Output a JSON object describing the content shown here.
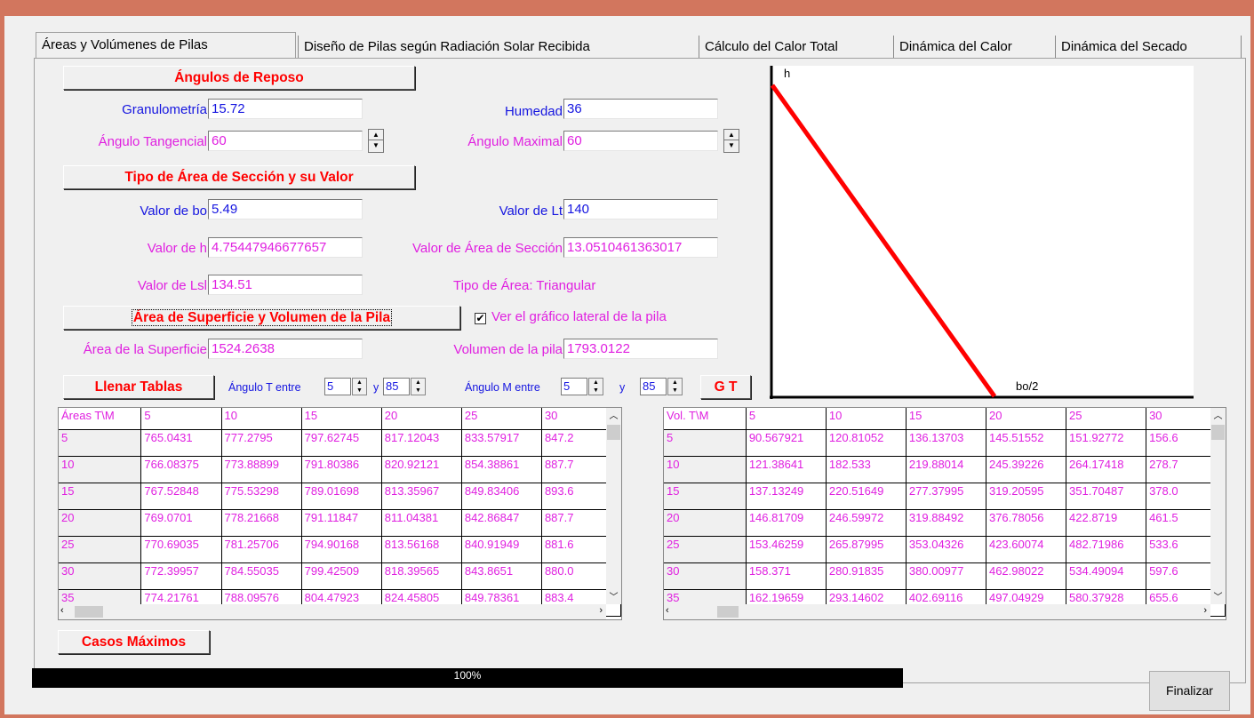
{
  "tabs": [
    "Áreas y Volúmenes de Pilas",
    "Diseño de Pilas según Radiación Solar Recibida",
    "Cálculo del Calor Total",
    "Dinámica del Calor",
    "Dinámica del Secado"
  ],
  "buttons": {
    "angulos_reposo": "Ángulos de Reposo",
    "tipo_area": "Tipo de Área de Sección y su Valor",
    "area_superficie": "Área de Superficie y Volumen de la Pila",
    "llenar_tablas": "Llenar Tablas",
    "gt": "G T",
    "casos_maximos": "Casos Máximos",
    "finalizar": "Finalizar"
  },
  "fields": {
    "granulometria": {
      "label": "Granulometría",
      "value": "15.72"
    },
    "humedad": {
      "label": "Humedad",
      "value": "36"
    },
    "angulo_tangencial": {
      "label": "Ángulo Tangencial",
      "value": "60"
    },
    "angulo_maximal": {
      "label": "Ángulo Maximal",
      "value": "60"
    },
    "valor_bo": {
      "label": "Valor de bo",
      "value": "5.49"
    },
    "valor_lt": {
      "label": "Valor de Lt",
      "value": "140"
    },
    "valor_h": {
      "label": "Valor de h",
      "value": "4.75447946677657"
    },
    "valor_area_seccion": {
      "label": "Valor de Área de Sección",
      "value": "13.0510461363017"
    },
    "valor_lsl": {
      "label": "Valor de Lsl",
      "value": "134.51"
    },
    "tipo_area": "Tipo de Área: Triangular",
    "area_superficie": {
      "label": "Área de la Superficie",
      "value": "1524.2638"
    },
    "volumen_pila": {
      "label": "Volumen de la pila",
      "value": "1793.0122"
    }
  },
  "checkbox": {
    "label": "Ver el gráfico lateral de la pila",
    "checked": "✔"
  },
  "range_controls": {
    "angulo_t_label": "Ángulo T entre",
    "angulo_t_min": "5",
    "angulo_t_max": "85",
    "y1": "y",
    "angulo_m_label": "Ángulo M entre",
    "angulo_m_min": "5",
    "angulo_m_max": "85",
    "y2": "y"
  },
  "chart": {
    "y_label": "h",
    "x_label": "bo/2"
  },
  "areas_table": {
    "headers": [
      "Áreas T\\M",
      "5",
      "10",
      "15",
      "20",
      "25",
      "30"
    ],
    "rows": [
      [
        "5",
        "765.0431",
        "777.2795",
        "797.62745",
        "817.12043",
        "833.57917",
        "847.2"
      ],
      [
        "10",
        "766.08375",
        "773.88899",
        "791.80386",
        "820.92121",
        "854.38861",
        "887.7"
      ],
      [
        "15",
        "767.52848",
        "775.53298",
        "789.01698",
        "813.35967",
        "849.83406",
        "893.6"
      ],
      [
        "20",
        "769.0701",
        "778.21668",
        "791.11847",
        "811.04381",
        "842.86847",
        "887.7"
      ],
      [
        "25",
        "770.69035",
        "781.25706",
        "794.90168",
        "813.56168",
        "840.91949",
        "881.6"
      ],
      [
        "30",
        "772.39957",
        "784.55035",
        "799.42509",
        "818.39565",
        "843.8651",
        "880.0"
      ],
      [
        "35",
        "774.21761",
        "788.09576",
        "804.47923",
        "824.45805",
        "849.78361",
        "883.4"
      ]
    ]
  },
  "vol_table": {
    "headers": [
      "Vol. T\\M",
      "5",
      "10",
      "15",
      "20",
      "25",
      "30"
    ],
    "rows": [
      [
        "5",
        "90.567921",
        "120.81052",
        "136.13703",
        "145.51552",
        "151.92772",
        "156.6"
      ],
      [
        "10",
        "121.38641",
        "182.533",
        "219.88014",
        "245.39226",
        "264.17418",
        "278.7"
      ],
      [
        "15",
        "137.13249",
        "220.51649",
        "277.37995",
        "319.20595",
        "351.70487",
        "378.0"
      ],
      [
        "20",
        "146.81709",
        "246.59972",
        "319.88492",
        "376.78056",
        "422.8719",
        "461.5"
      ],
      [
        "25",
        "153.46259",
        "265.87995",
        "353.04326",
        "423.60074",
        "482.71986",
        "533.6"
      ],
      [
        "30",
        "158.371",
        "280.91835",
        "380.00977",
        "462.98022",
        "534.49094",
        "597.6"
      ],
      [
        "35",
        "162.19659",
        "293.14602",
        "402.69116",
        "497.04929",
        "580.37928",
        "655.6"
      ]
    ]
  },
  "progress": {
    "text": "100%",
    "value": 1.0
  }
}
